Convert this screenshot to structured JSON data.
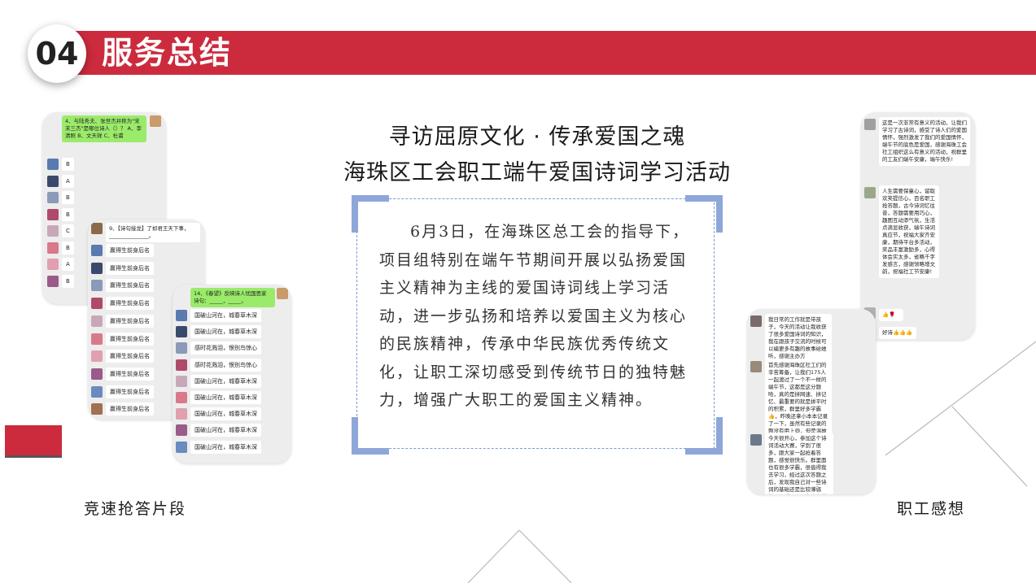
{
  "header": {
    "number": "04",
    "title": "服务总结"
  },
  "main": {
    "title_line1": "寻访屈原文化 · 传承爱国之魂",
    "title_line2": "海珠区工会职工端午爱国诗词学习活动",
    "body": "6月3日，在海珠区总工会的指导下，项目组特别在端午节期间开展以弘扬爱国主义精神为主线的爱国诗词线上学习活动，进一步弘扬和培养以爱国主义为核心的民族精神，传承中华民族优秀传统文化，让职工深切感受到传统节日的独特魅力，增强广大职工的爱国主义精神。"
  },
  "captions": {
    "left": "竞速抢答片段",
    "right": "职工感想"
  },
  "quiz_panel_1": {
    "question": "4、与陆秀夫、张世杰并称为\"宋末三杰\"是哪位诗人（）？ A、李清照 B、文天祥 C、杜甫",
    "answers": [
      "B",
      "A",
      "B",
      "B",
      "C",
      "B",
      "A",
      "B"
    ]
  },
  "quiz_panel_2": {
    "question": "9、【诗句接龙】了却君王天下事，_______________。",
    "answers": [
      "赢得生前身后名",
      "赢得生前身后名",
      "赢得生前身后名",
      "赢得生前身后名",
      "赢得生前身后名",
      "赢得生前身后名",
      "赢得生前身后名",
      "赢得生前身后名",
      "赢得生前身后名",
      "赢得生前身后名",
      "赢得生前身后名"
    ]
  },
  "quiz_panel_3": {
    "question": "14、《春望》反映诗人忧国思家诗句：_____，_____。",
    "answers": [
      "国破山河在，城春草木深",
      "国破山河在，城春草木深",
      "感时花溅泪，恨别鸟惊心",
      "感时花溅泪，恨别鸟惊心",
      "国破山河在，城春草木深",
      "国破山河在，城春草木深",
      "国破山河在，城春草木深",
      "国破山河在，城春草木深",
      "国破山河在，城春草木深"
    ]
  },
  "feedback_panel_1": {
    "msg1": "这是一次非常有意义的活动，让我们学习了古诗词，感受了诗人们的爱国情怀，强烈激发了我们的爱国情怀，端午节的底色是爱国，感谢海珠工会社工组织这么有意义的活动，祝群里的工友们端午安康，端午快乐!",
    "msg2": "人生需要保童心，留取欢笑提信心，百名职工抢答题，古今诗词忆往昔，答题需要用巧心，趣图互动添气氛，生活点滴显收获，端午诗词真应节，祝福大家齐安康，期待平台多活动，奖品丰富激励多，心得体会实太多，省略千字发感言，感谢领略增文韵，祝福社工节安康!",
    "msg3": "👍🌹",
    "msg4": "好诗👍👍👍"
  },
  "feedback_panel_2": {
    "msg1": "我日常的工作就是带孩子，今天的活动让我收获了很多爱国诗词的知识，我在跟孩子交流的时候可以编更多有趣的故事给她听，感谢主办方",
    "msg2": "首先感谢海珠区社工们的辛苦筹备，让我们175人一起渡过了一个不一样的端午节，这都是这分题哈，真的是拼网速、拼记忆、最重要的就是拼平时的积累，群里好多学霸👍，昨晚还拿小本本记录了一下，虽然有些记录的题没有用上😄，但是温故而知新，感谢社工们的付出，祝大家端午安康!🌹",
    "msg3": "今天很开心，参加这个诗词活动大赛，学到了很多，跟大家一起抢着答题，感觉很快乐。群里面也有很多学霸，很值得我去学习，经过这次答题之后，发现我自己对一些诗词的基础还是比较薄弱的，以后还是要多点去学习，不断的黑陶自己🌹"
  },
  "colors": {
    "accent_red": "#cc2b3e",
    "bracket_blue": "#8ea7d9",
    "wechat_green": "#9beb6a"
  }
}
